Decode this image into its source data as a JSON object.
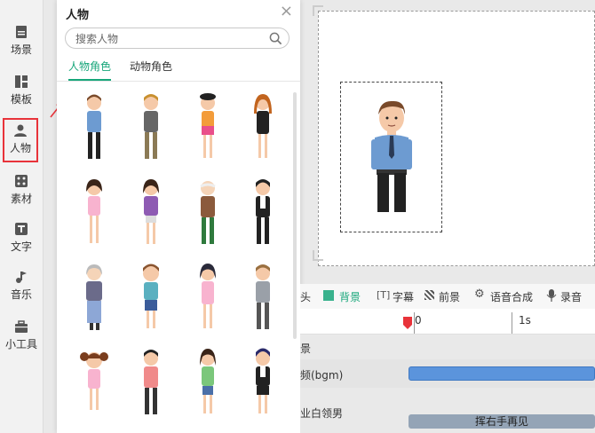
{
  "sidebar": {
    "items": [
      {
        "label": "场景",
        "icon": "scene-icon"
      },
      {
        "label": "模板",
        "icon": "template-icon"
      },
      {
        "label": "人物",
        "icon": "person-icon",
        "active": true
      },
      {
        "label": "素材",
        "icon": "material-icon"
      },
      {
        "label": "文字",
        "icon": "text-icon"
      },
      {
        "label": "音乐",
        "icon": "music-icon"
      },
      {
        "label": "小工具",
        "icon": "toolbox-icon"
      }
    ]
  },
  "panel": {
    "title": "人物",
    "search_placeholder": "搜索人物",
    "tabs": [
      {
        "label": "人物角色",
        "active": true
      },
      {
        "label": "动物角色",
        "active": false
      }
    ]
  },
  "timeline": {
    "tabs": [
      {
        "label": "头",
        "icon": ""
      },
      {
        "label": "背景",
        "icon": "background-icon",
        "active": true
      },
      {
        "label": "字幕",
        "icon": "subtitle-icon"
      },
      {
        "label": "前景",
        "icon": "foreground-icon"
      },
      {
        "label": "语音合成",
        "icon": "tts-icon"
      },
      {
        "label": "录音",
        "icon": "mic-icon"
      }
    ],
    "ruler": {
      "mark0": "0",
      "mark1": "1s"
    },
    "rows": {
      "scene_label": "景",
      "bgm_label": "频(bgm)",
      "voice_label": "业白领男",
      "voice_clip_text": "挥右手再见"
    }
  },
  "colors": {
    "accent": "#17a67a",
    "active_outline": "#e8333a",
    "bgm_track": "#5b94dc",
    "voice_track": "#94a4b6"
  }
}
